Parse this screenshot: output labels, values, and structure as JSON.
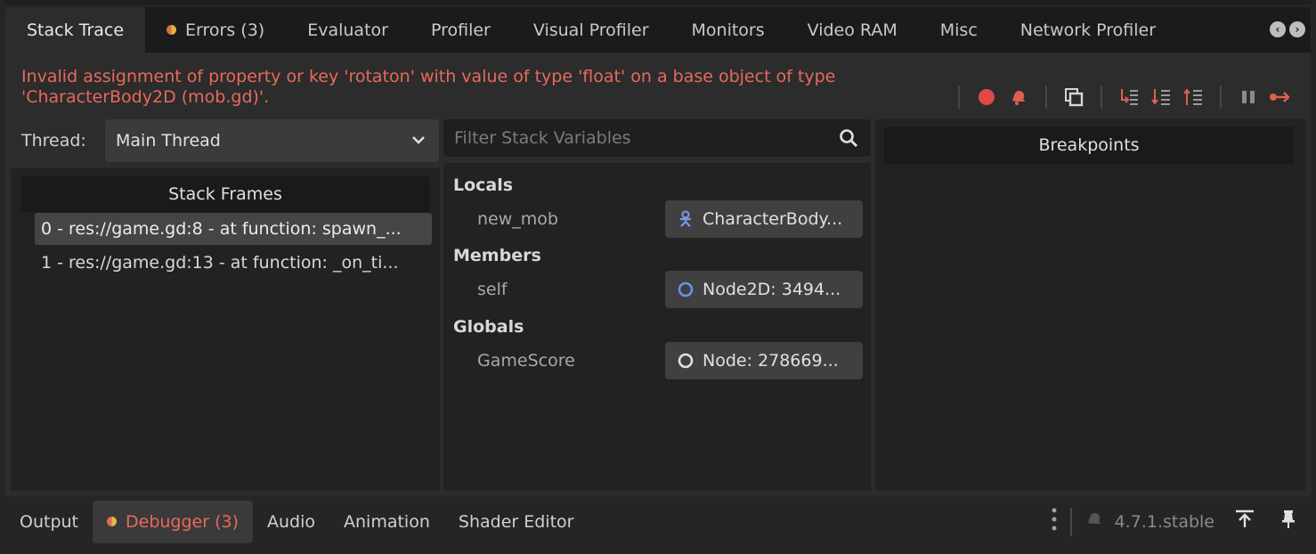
{
  "tabs": [
    {
      "label": "Stack Trace",
      "active": true
    },
    {
      "label": "Errors (3)",
      "has_error_dot": true
    },
    {
      "label": "Evaluator"
    },
    {
      "label": "Profiler"
    },
    {
      "label": "Visual Profiler"
    },
    {
      "label": "Monitors"
    },
    {
      "label": "Video RAM"
    },
    {
      "label": "Misc"
    },
    {
      "label": "Network Profiler"
    }
  ],
  "error_message": "Invalid assignment of property or key 'rotaton' with value of type 'float' on a base object of type 'CharacterBody2D (mob.gd)'.",
  "toolbar_icons": [
    "record-icon",
    "alert-icon",
    "copy-icon",
    "step-into-icon",
    "step-over-icon",
    "step-out-icon",
    "pause-icon",
    "continue-icon"
  ],
  "thread": {
    "label": "Thread:",
    "selected": "Main Thread"
  },
  "stack_frames": {
    "header": "Stack Frames",
    "rows": [
      "0 - res://game.gd:8 - at function: spawn_...",
      "1 - res://game.gd:13 - at function: _on_ti..."
    ],
    "selected_index": 0
  },
  "filter": {
    "placeholder": "Filter Stack Variables"
  },
  "variables": {
    "locals_label": "Locals",
    "members_label": "Members",
    "globals_label": "Globals",
    "locals": [
      {
        "name": "new_mob",
        "value": "CharacterBody...",
        "icon": "character-body-icon"
      }
    ],
    "members": [
      {
        "name": "self",
        "value": "Node2D: 3494...",
        "icon": "node2d-icon"
      }
    ],
    "globals": [
      {
        "name": "GameScore",
        "value": "Node: 278669...",
        "icon": "node-icon"
      }
    ]
  },
  "breakpoints": {
    "header": "Breakpoints"
  },
  "bottom_tabs": [
    {
      "label": "Output"
    },
    {
      "label": "Debugger (3)",
      "active": true,
      "has_error_dot": true
    },
    {
      "label": "Audio"
    },
    {
      "label": "Animation"
    },
    {
      "label": "Shader Editor"
    }
  ],
  "version": "4.7.1.stable",
  "colors": {
    "error_text": "#e8695c",
    "record_red": "#e04848",
    "node2d_blue": "#6e8ef0",
    "panel_bg": "#2c2c2c"
  }
}
